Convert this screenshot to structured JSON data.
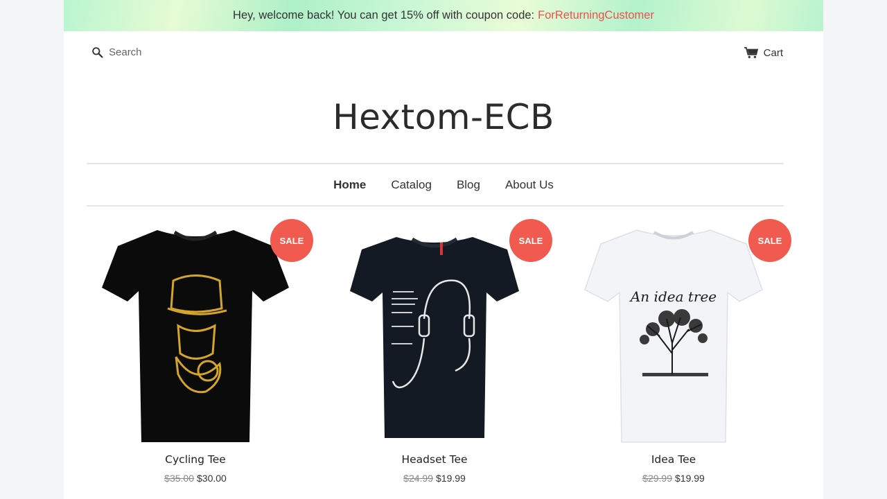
{
  "announcement": {
    "text": "Hey, welcome back! You can get 15% off with coupon code:",
    "coupon": "ForReturningCustomer",
    "coupon_color": "#f04f4f"
  },
  "header": {
    "search_label": "Search",
    "search_icon": "search-icon",
    "cart_label": "Cart",
    "cart_icon": "cart-icon",
    "brand": "Hextom-ECB"
  },
  "nav": {
    "items": [
      {
        "label": "Home",
        "active": true
      },
      {
        "label": "Catalog",
        "active": false
      },
      {
        "label": "Blog",
        "active": false
      },
      {
        "label": "About Us",
        "active": false
      }
    ]
  },
  "products": [
    {
      "name": "Cycling Tee",
      "old_price": "$35.00",
      "price": "$30.00",
      "badge": "SALE",
      "shirt_color": "#0b0b0b",
      "print": "gold-face"
    },
    {
      "name": "Headset Tee",
      "old_price": "$24.99",
      "price": "$19.99",
      "badge": "SALE",
      "shirt_color": "#141a24",
      "print": "headphones"
    },
    {
      "name": "Idea Tee",
      "old_price": "$29.99",
      "price": "$19.99",
      "badge": "SALE",
      "shirt_color": "#f2f4f7",
      "print": "An idea tree"
    }
  ],
  "colors": {
    "sale_badge": "#f15a4e"
  }
}
